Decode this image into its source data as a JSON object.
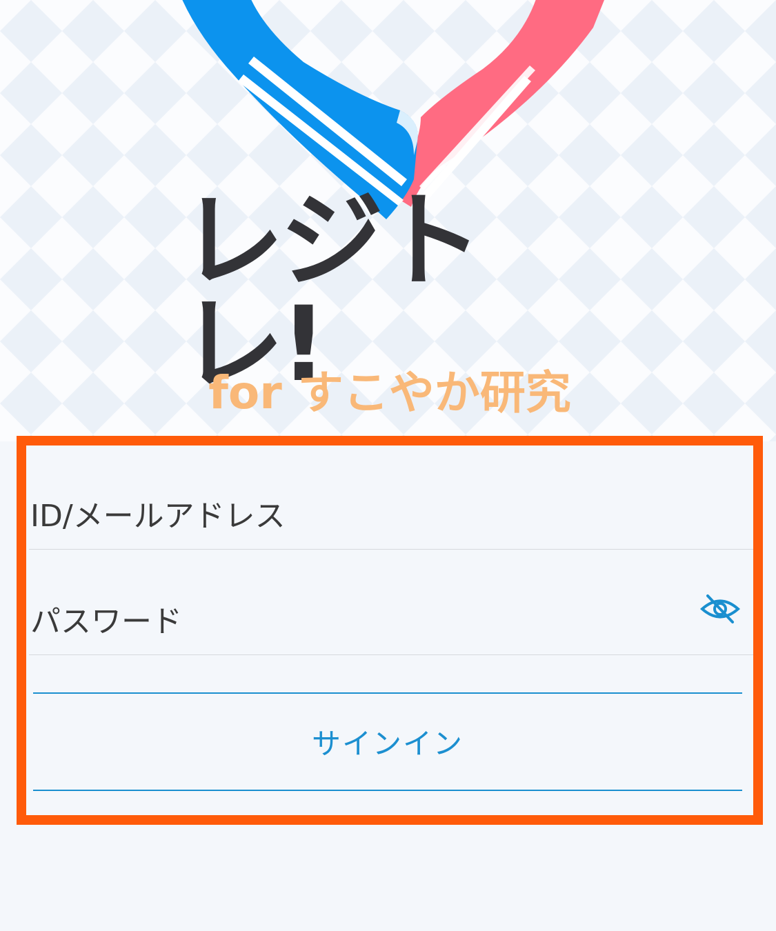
{
  "app": {
    "title": "レジトレ!",
    "subtitle": "for すこやか研究",
    "logo_icon": "heart-hands-icon"
  },
  "colors": {
    "brand_blue": "#0c93ee",
    "brand_pink": "#ff6b82",
    "title_dark": "#333337",
    "subtitle_orange": "#f9b878",
    "accent_blue": "#1a8fcf",
    "highlight_orange": "#ff5b0a"
  },
  "form": {
    "id_placeholder": "ID/メールアドレス",
    "password_placeholder": "パスワード",
    "password_toggle_icon": "eye-off-icon",
    "signin_label": "サインイン"
  }
}
